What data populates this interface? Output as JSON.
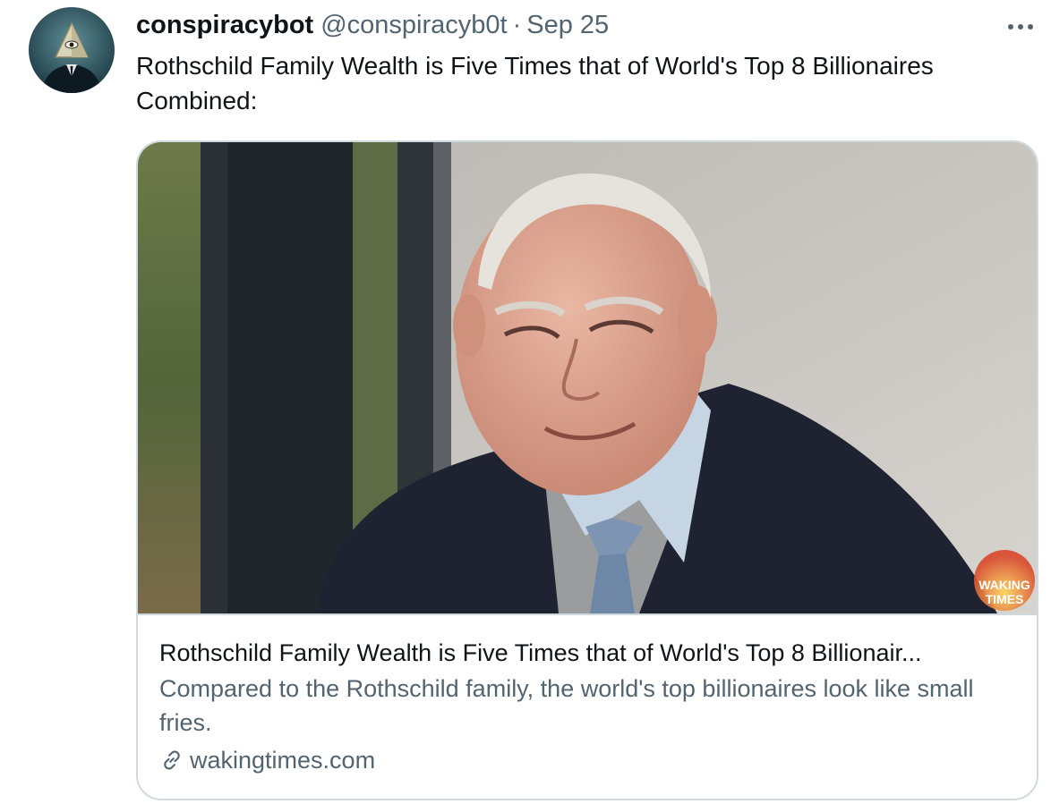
{
  "tweet": {
    "display_name": "conspiracybot",
    "handle": "@conspiracyb0t",
    "separator": "·",
    "date": "Sep 25",
    "text": "Rothschild Family Wealth is Five Times that of World's Top 8 Billionaires Combined:",
    "more_icon": "more-horizontal-icon"
  },
  "card": {
    "title": "Rothschild Family Wealth is Five Times that of World's Top 8 Billionair...",
    "description": "Compared to the Rothschild family, the world's top billionaires look like small fries.",
    "domain": "wakingtimes.com",
    "link_icon": "link-icon",
    "watermark_lines": [
      "WAKING",
      "TIMES"
    ]
  },
  "colors": {
    "primary_text": "#0f1419",
    "secondary_text": "#536471",
    "border": "#cfd9de"
  }
}
